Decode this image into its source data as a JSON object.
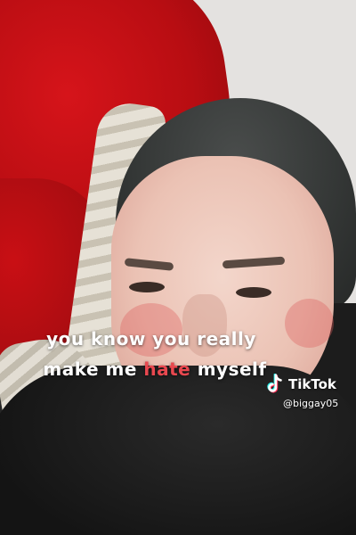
{
  "caption": {
    "line1": "you know you really",
    "line2_before": "make me ",
    "line2_highlight": "hate",
    "line2_after": " myself"
  },
  "watermark": {
    "brand": "TikTok",
    "username": "@biggay05",
    "icon": "tiktok-logo-icon"
  },
  "colors": {
    "highlight": "#e8484f",
    "caption_text": "#ffffff",
    "tiktok_cyan": "#25f4ee",
    "tiktok_red": "#fe2c55"
  }
}
